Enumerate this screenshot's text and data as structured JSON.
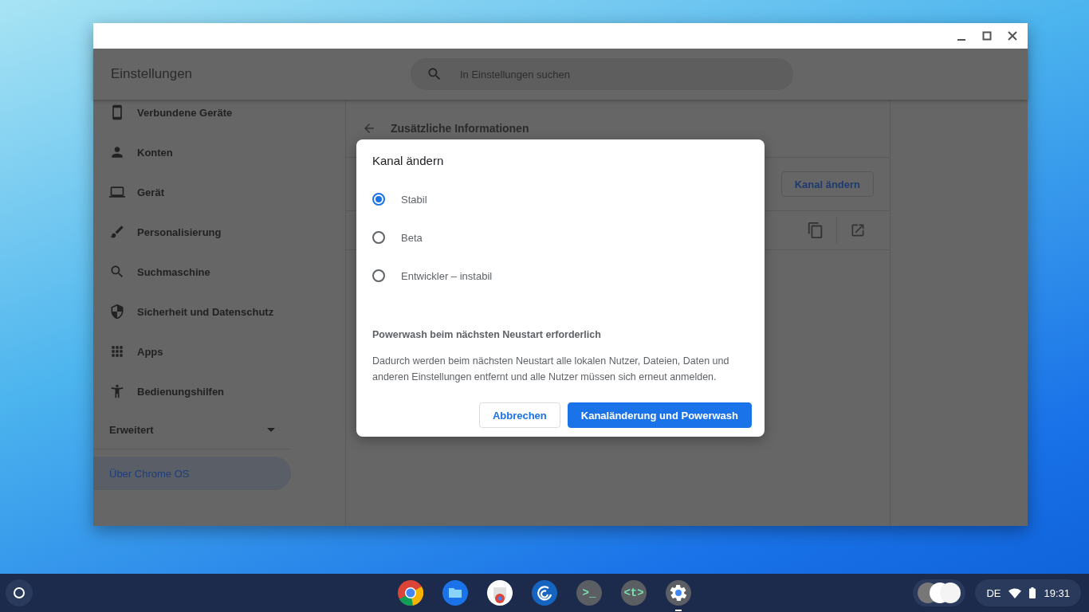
{
  "app": {
    "title": "Einstellungen",
    "search": {
      "placeholder": "In Einstellungen suchen"
    }
  },
  "sidebar": {
    "items": [
      {
        "label": "Verbundene Geräte"
      },
      {
        "label": "Konten"
      },
      {
        "label": "Gerät"
      },
      {
        "label": "Personalisierung"
      },
      {
        "label": "Suchmaschine"
      },
      {
        "label": "Sicherheit und Datenschutz"
      },
      {
        "label": "Apps"
      },
      {
        "label": "Bedienungshilfen"
      }
    ],
    "advanced": {
      "label": "Erweitert"
    },
    "about": {
      "label": "Über Chrome OS",
      "selected": true
    }
  },
  "content": {
    "title": "Zusätzliche Informationen",
    "change_channel_button": "Kanal ändern"
  },
  "dialog": {
    "title": "Kanal ändern",
    "options": [
      {
        "label": "Stabil",
        "selected": true
      },
      {
        "label": "Beta",
        "selected": false
      },
      {
        "label": "Entwickler – instabil",
        "selected": false
      }
    ],
    "warning_title": "Powerwash beim nächsten Neustart erforderlich",
    "warning_text": "Dadurch werden beim nächsten Neustart alle lokalen Nutzer, Dateien, Daten und anderen Einstellungen entfernt und alle Nutzer müssen sich erneut anmelden.",
    "buttons": [
      {
        "label": "Abbrechen",
        "kind": "secondary"
      },
      {
        "label": "Kanaländerung und Powerwash",
        "kind": "primary"
      }
    ]
  },
  "taskbar": {
    "apps": [
      {
        "kind": "chrome",
        "selected": false
      },
      {
        "kind": "files",
        "selected": false
      },
      {
        "kind": "webstore",
        "selected": false
      },
      {
        "kind": "swirl",
        "selected": false
      },
      {
        "kind": "terminal",
        "glyph": ">_",
        "selected": false
      },
      {
        "kind": "text",
        "glyph": "<t>",
        "selected": false
      },
      {
        "kind": "settings",
        "selected": true
      }
    ],
    "status": {
      "ime": "DE",
      "time": "19:31"
    }
  }
}
